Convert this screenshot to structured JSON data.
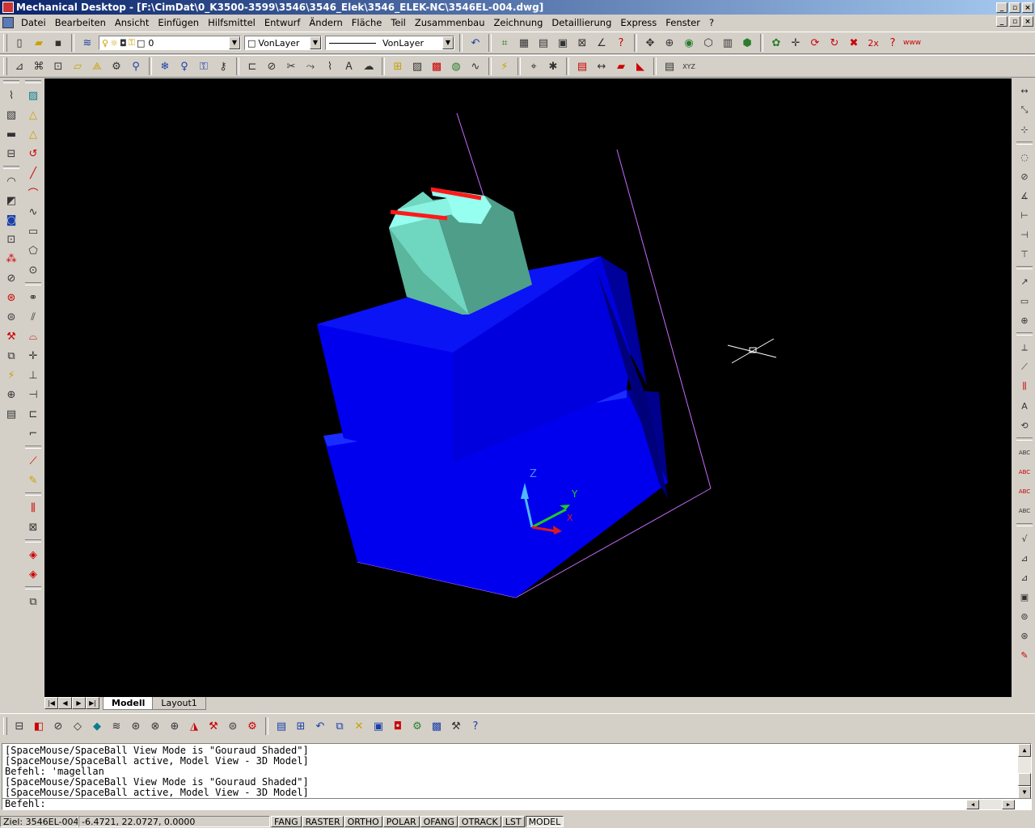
{
  "window": {
    "title": "Mechanical Desktop - [F:\\CimDat\\0_K3500-3599\\3546\\3546_Elek\\3546_ELEK-NC\\3546EL-004.dwg]"
  },
  "menu": [
    "Datei",
    "Bearbeiten",
    "Ansicht",
    "Einfügen",
    "Hilfsmittel",
    "Entwurf",
    "Ändern",
    "Fläche",
    "Teil",
    "Zusammenbau",
    "Zeichnung",
    "Detaillierung",
    "Express",
    "Fenster",
    "?"
  ],
  "toolbar": {
    "layer_value": "0",
    "color_value": "VonLayer",
    "linetype_value": "VonLayer",
    "zoom_label": "2x",
    "help_label": "?",
    "www_label": "www",
    "xyz_label": "XYZ"
  },
  "viewport": {
    "background": "#000000",
    "axis_labels": {
      "z": "Z",
      "y": "Y",
      "x": "X"
    },
    "colors": {
      "body_front": "#0000ee",
      "body_top": "#0a14f5",
      "body_side": "#0000a8",
      "insert_front": "#63c9ad",
      "insert_top": "#96fff0",
      "edge_red": "#ff1a1a",
      "boundary": "#c86bff"
    }
  },
  "tabs": {
    "model": "Modell",
    "layout": "Layout1"
  },
  "command": {
    "history": [
      "[SpaceMouse/SpaceBall View Mode is \"Gouraud Shaded\"]",
      "[SpaceMouse/SpaceBall active, Model View - 3D Model]",
      "Befehl: 'magellan",
      "[SpaceMouse/SpaceBall View Mode is \"Gouraud Shaded\"]",
      "[SpaceMouse/SpaceBall active, Model View - 3D Model]"
    ],
    "prompt": "Befehl:"
  },
  "status": {
    "target": "Ziel: 3546EL-004",
    "coords": "-6.4721, 22.0727, 0.0000",
    "buttons": [
      "FANG",
      "RASTER",
      "ORTHO",
      "POLAR",
      "OFANG",
      "OTRACK",
      "LST",
      "MODEL"
    ]
  }
}
